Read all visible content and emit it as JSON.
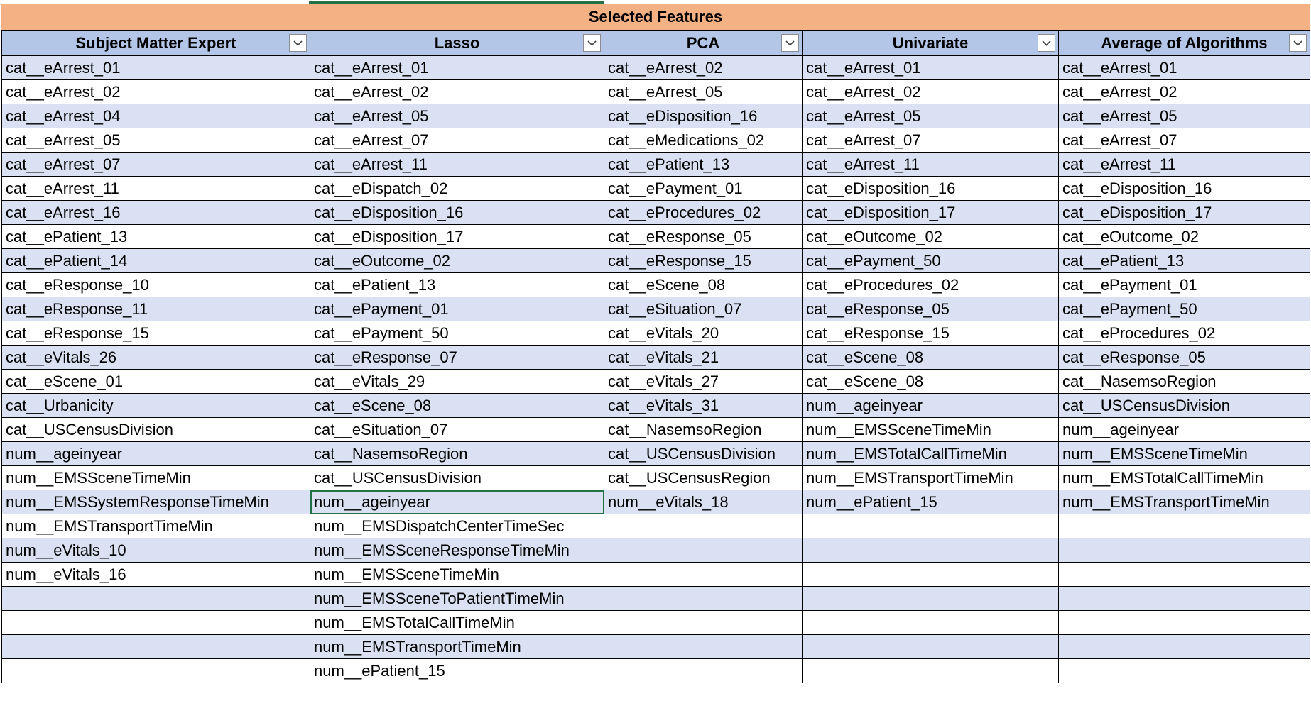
{
  "sheet": {
    "title": "Selected Features",
    "columns": [
      {
        "label": "Subject Matter Expert",
        "filter_icon": "chevron-down-icon"
      },
      {
        "label": "Lasso",
        "filter_icon": "chevron-down-icon"
      },
      {
        "label": "PCA",
        "filter_icon": "chevron-down-icon"
      },
      {
        "label": "Univariate",
        "filter_icon": "chevron-down-icon"
      },
      {
        "label": "Average of Algorithms",
        "filter_icon": "chevron-down-icon"
      }
    ],
    "rows": [
      [
        "cat__eArrest_01",
        "cat__eArrest_01",
        "cat__eArrest_02",
        "cat__eArrest_01",
        "cat__eArrest_01"
      ],
      [
        "cat__eArrest_02",
        "cat__eArrest_02",
        "cat__eArrest_05",
        "cat__eArrest_02",
        "cat__eArrest_02"
      ],
      [
        "cat__eArrest_04",
        "cat__eArrest_05",
        "cat__eDisposition_16",
        "cat__eArrest_05",
        "cat__eArrest_05"
      ],
      [
        "cat__eArrest_05",
        "cat__eArrest_07",
        "cat__eMedications_02",
        "cat__eArrest_07",
        "cat__eArrest_07"
      ],
      [
        "cat__eArrest_07",
        "cat__eArrest_11",
        "cat__ePatient_13",
        "cat__eArrest_11",
        "cat__eArrest_11"
      ],
      [
        "cat__eArrest_11",
        "cat__eDispatch_02",
        "cat__ePayment_01",
        "cat__eDisposition_16",
        "cat__eDisposition_16"
      ],
      [
        "cat__eArrest_16",
        "cat__eDisposition_16",
        "cat__eProcedures_02",
        "cat__eDisposition_17",
        "cat__eDisposition_17"
      ],
      [
        "cat__ePatient_13",
        "cat__eDisposition_17",
        "cat__eResponse_05",
        "cat__eOutcome_02",
        "cat__eOutcome_02"
      ],
      [
        "cat__ePatient_14",
        "cat__eOutcome_02",
        "cat__eResponse_15",
        "cat__ePayment_50",
        "cat__ePatient_13"
      ],
      [
        "cat__eResponse_10",
        "cat__ePatient_13",
        "cat__eScene_08",
        "cat__eProcedures_02",
        "cat__ePayment_01"
      ],
      [
        "cat__eResponse_11",
        "cat__ePayment_01",
        "cat__eSituation_07",
        "cat__eResponse_05",
        "cat__ePayment_50"
      ],
      [
        "cat__eResponse_15",
        "cat__ePayment_50",
        "cat__eVitals_20",
        "cat__eResponse_15",
        "cat__eProcedures_02"
      ],
      [
        "cat__eVitals_26",
        "cat__eResponse_07",
        "cat__eVitals_21",
        "cat__eScene_08",
        "cat__eResponse_05"
      ],
      [
        "cat__eScene_01",
        "cat__eVitals_29",
        "cat__eVitals_27",
        "cat__eScene_08",
        "cat__NasemsoRegion"
      ],
      [
        "cat__Urbanicity",
        "cat__eScene_08",
        "cat__eVitals_31",
        "num__ageinyear",
        "cat__USCensusDivision"
      ],
      [
        "cat__USCensusDivision",
        "cat__eSituation_07",
        "cat__NasemsoRegion",
        "num__EMSSceneTimeMin",
        "num__ageinyear"
      ],
      [
        "num__ageinyear",
        "cat__NasemsoRegion",
        "cat__USCensusDivision",
        "num__EMSTotalCallTimeMin",
        "num__EMSSceneTimeMin"
      ],
      [
        "num__EMSSceneTimeMin",
        "cat__USCensusDivision",
        "cat__USCensusRegion",
        "num__EMSTransportTimeMin",
        "num__EMSTotalCallTimeMin"
      ],
      [
        "num__EMSSystemResponseTimeMin",
        "num__ageinyear",
        "num__eVitals_18",
        "num__ePatient_15",
        "num__EMSTransportTimeMin"
      ],
      [
        "num__EMSTransportTimeMin",
        "num__EMSDispatchCenterTimeSec",
        "",
        "",
        ""
      ],
      [
        "num__eVitals_10",
        "num__EMSSceneResponseTimeMin",
        "",
        "",
        ""
      ],
      [
        "num__eVitals_16",
        "num__EMSSceneTimeMin",
        "",
        "",
        ""
      ],
      [
        "",
        "num__EMSSceneToPatientTimeMin",
        "",
        "",
        ""
      ],
      [
        "",
        "num__EMSTotalCallTimeMin",
        "",
        "",
        ""
      ],
      [
        "",
        "num__EMSTransportTimeMin",
        "",
        "",
        ""
      ],
      [
        "",
        "num__ePatient_15",
        "",
        "",
        ""
      ]
    ],
    "active_cell": {
      "row": 18,
      "col": 1
    },
    "colors": {
      "title_fill": "#f4b183",
      "header_fill": "#b4c6e7",
      "band_fill": "#d9e1f2",
      "selection_border": "#217346"
    }
  }
}
